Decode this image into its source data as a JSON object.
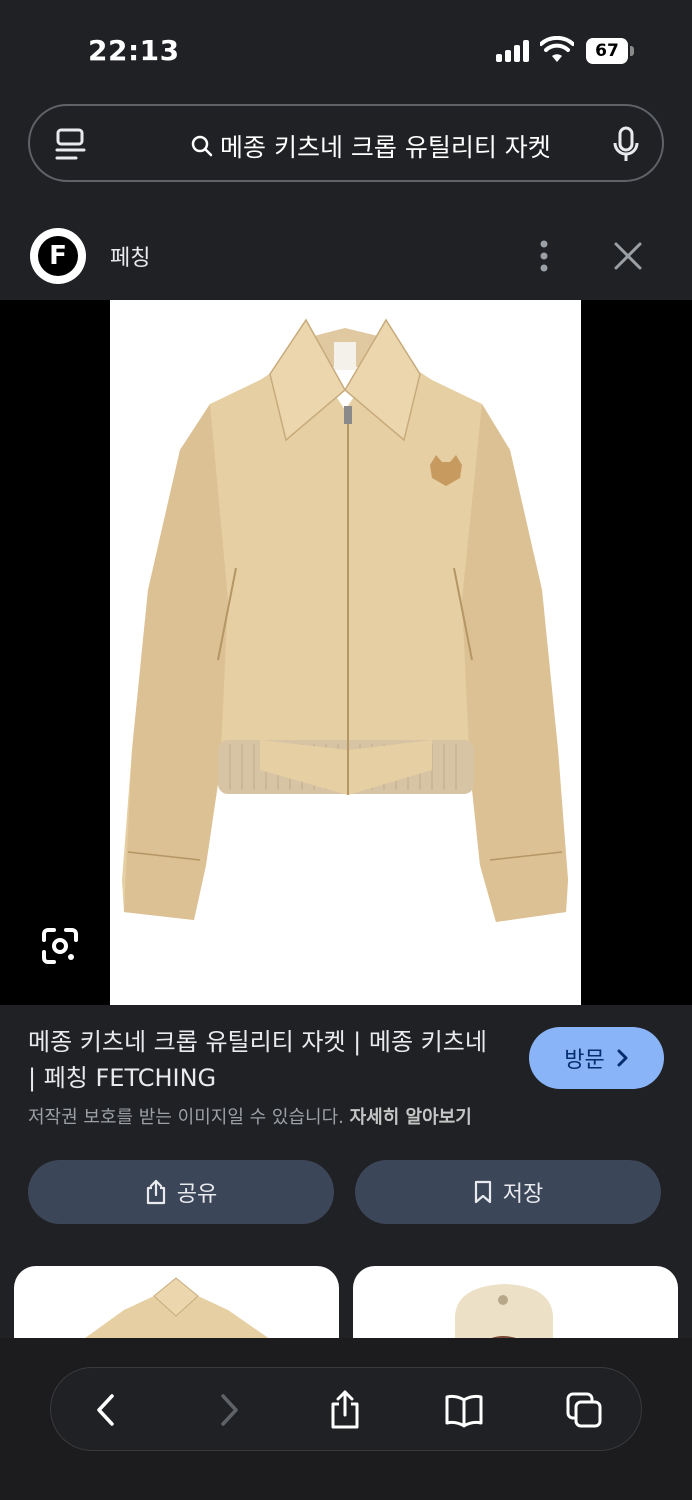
{
  "status_bar": {
    "time": "22:13",
    "battery": "67"
  },
  "search": {
    "query": "메종 키츠네 크롭 유틸리티 자켓"
  },
  "source": {
    "favicon_letter": "F",
    "name": "페칭"
  },
  "result": {
    "title": "메종 키츠네 크롭 유틸리티 자켓 | 메종 키츠네 | 페칭 FETCHING",
    "visit_label": "방문",
    "copyright_notice": "저작권 보호를 받는 이미지일 수 있습니다.",
    "learn_more": "자세히 알아보기"
  },
  "actions": {
    "share_label": "공유",
    "save_label": "저장"
  },
  "colors": {
    "accent": "#8ab4f8",
    "background": "#202124",
    "action_button": "#3c4659"
  },
  "icons": {
    "search_menu": "history-menu-icon",
    "search": "search-icon",
    "mic": "mic-icon",
    "more": "more-vert-icon",
    "close": "close-icon",
    "lens": "lens-icon",
    "share": "share-icon",
    "save": "bookmark-icon",
    "toolbar": [
      "back-icon",
      "forward-icon",
      "share-icon",
      "bookmarks-icon",
      "tabs-icon"
    ]
  }
}
